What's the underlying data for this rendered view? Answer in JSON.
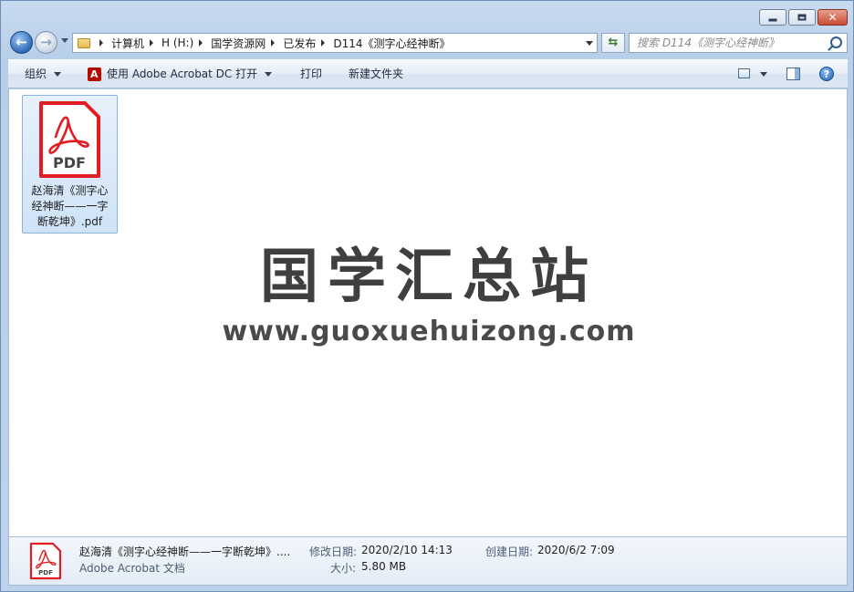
{
  "nav": {
    "back_icon": "back-arrow-icon",
    "forward_icon": "forward-arrow-icon",
    "breadcrumbs": [
      "计算机",
      "H (H:)",
      "国学资源网",
      "已发布",
      "D114《测字心经神断》"
    ],
    "search_placeholder": "搜索 D114《测字心经神断》"
  },
  "toolbar": {
    "organize_label": "组织",
    "open_with_label": "使用 Adobe Acrobat DC 打开",
    "print_label": "打印",
    "new_folder_label": "新建文件夹"
  },
  "file": {
    "icon": "pdf-file-icon",
    "icon_text": "PDF",
    "name_lines": [
      "赵海清《测字心",
      "经神断——一字",
      "断乾坤》.pdf"
    ],
    "accent_color": "#e21c23"
  },
  "watermark": {
    "title": "国学汇总站",
    "url": "www.guoxuehuizong.com"
  },
  "details": {
    "name": "赵海清《测字心经神断——一字断乾坤》....",
    "type": "Adobe Acrobat 文档",
    "modified_label": "修改日期:",
    "modified_value": "2020/2/10 14:13",
    "size_label": "大小:",
    "size_value": "5.80 MB",
    "created_label": "创建日期:",
    "created_value": "2020/6/2 7:09",
    "icon_text": "PDF"
  }
}
